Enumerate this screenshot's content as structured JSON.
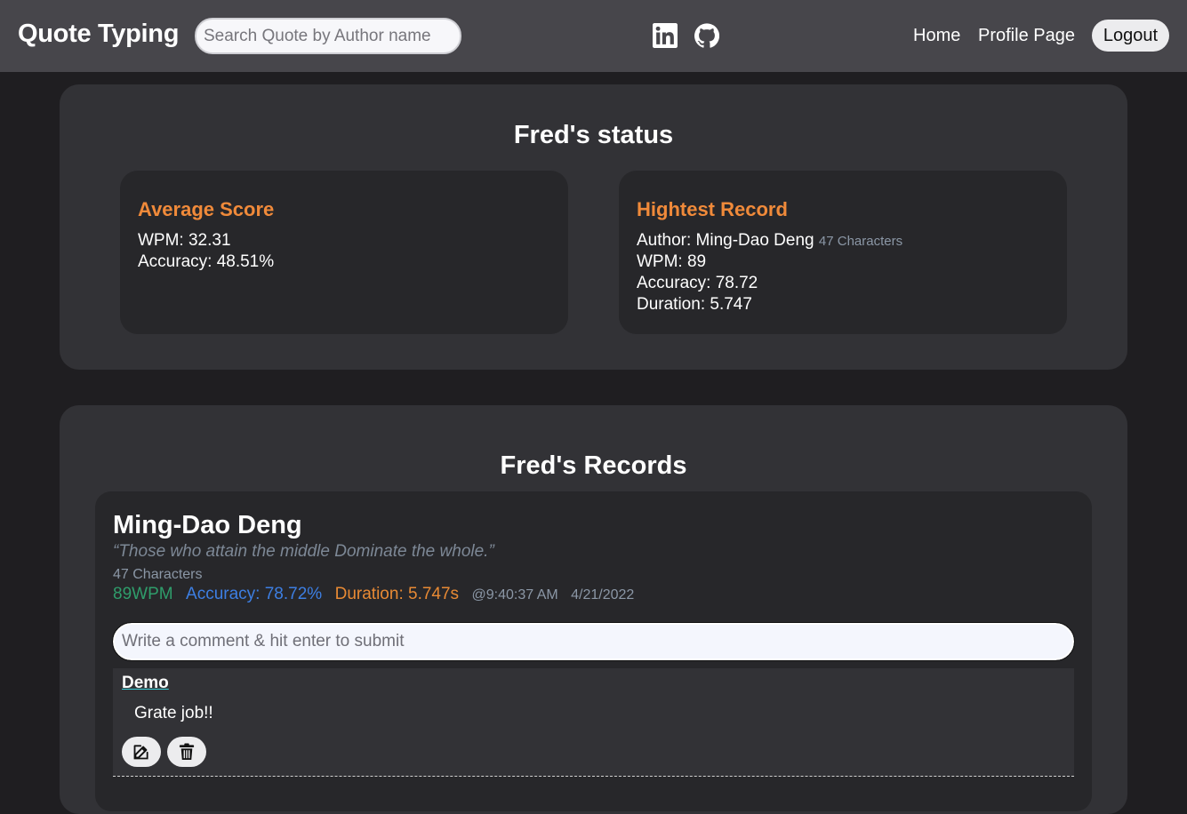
{
  "navbar": {
    "brand": "Quote Typing",
    "search_placeholder": "Search Quote by Author name",
    "links": {
      "home": "Home",
      "profile": "Profile Page"
    },
    "logout_label": "Logout",
    "icons": [
      "linkedin-icon",
      "github-icon"
    ]
  },
  "status": {
    "title": "Fred's status",
    "average": {
      "heading": "Average Score",
      "wpm": "WPM: 32.31",
      "accuracy": "Accuracy: 48.51%"
    },
    "highest": {
      "heading": "Hightest Record",
      "author": "Author: Ming-Dao Deng",
      "characters": "47 Characters",
      "wpm": "WPM: 89",
      "accuracy": "Accuracy: 78.72",
      "duration": "Duration: 5.747"
    }
  },
  "records": {
    "title": "Fred's Records",
    "items": [
      {
        "author": "Ming-Dao Deng",
        "quote": "“Those who attain the middle Dominate the whole.”",
        "characters": "47 Characters",
        "wpm": "89WPM",
        "accuracy": "Accuracy: 78.72%",
        "duration": "Duration: 5.747s",
        "time": "@9:40:37 AM",
        "date": "4/21/2022",
        "comment_placeholder": "Write a comment & hit enter to submit",
        "comments": [
          {
            "user": "Demo",
            "text": "Grate job!!"
          }
        ]
      }
    ]
  },
  "colors": {
    "navbar_bg": "#47464b",
    "page_bg": "#1f1e21",
    "card_bg": "#323236",
    "inner_bg": "#27272a",
    "heading_orange": "#f08a3a",
    "wpm_green": "#2f9d6b",
    "accuracy_blue": "#3d7fe3",
    "duration_orange": "#e88a34",
    "muted": "#8b97a6"
  }
}
